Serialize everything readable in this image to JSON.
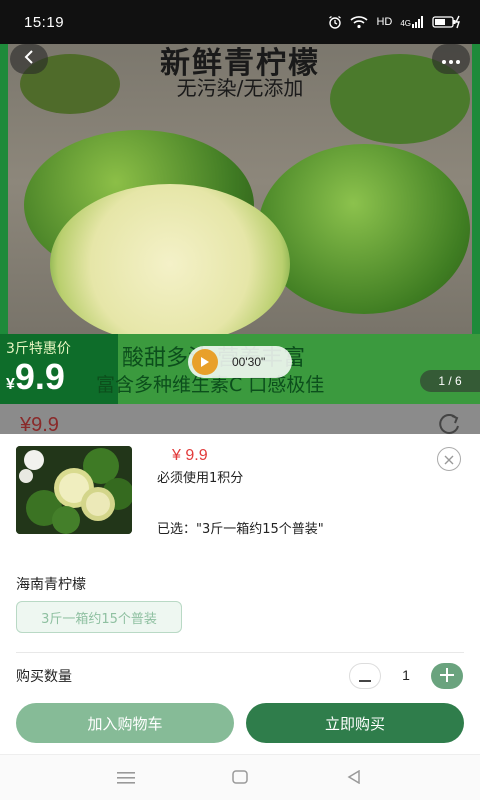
{
  "status_bar": {
    "time": "15:19",
    "network_label": "HD",
    "signal_label": "4G"
  },
  "hero": {
    "title": "新鲜青柠檬",
    "subtitle": "无污染/无添加",
    "promo_label": "3斤特惠价",
    "promo_currency": "¥",
    "promo_price": "9.9",
    "promo_line1": "酸甜多汁 营养丰富",
    "promo_line2": "富含多种维生素C 口感极佳",
    "video_duration": "00'30\"",
    "page_indicator": "1 / 6"
  },
  "peek": {
    "price": "¥9.9"
  },
  "sheet": {
    "price": "¥ 9.9",
    "points_note": "必须使用1积分",
    "selected_text": "已选：\"3斤一箱约15个普装\"",
    "spec_group_title": "海南青柠檬",
    "spec_options": [
      "3斤一箱约15个普装"
    ],
    "quantity_label": "购买数量",
    "quantity": "1",
    "add_to_cart": "加入购物车",
    "buy_now": "立即购买"
  },
  "colors": {
    "accent": "#2f7d4b",
    "accent_light": "#86bb97",
    "price_red": "#e23b3b"
  },
  "icons": [
    "wifi-icon",
    "alarm-icon",
    "battery-icon",
    "back-icon",
    "more-icon",
    "play-icon",
    "share-icon",
    "close-icon",
    "minus-icon",
    "plus-icon",
    "menu-nav-icon",
    "home-nav-icon",
    "back-nav-icon"
  ]
}
